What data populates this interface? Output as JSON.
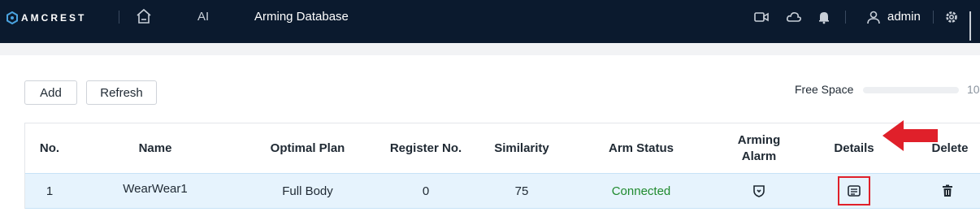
{
  "brand": {
    "logo_text": "AMCREST",
    "logo_icon": "hexagon-logo-icon"
  },
  "nav": {
    "home_icon": "home-icon",
    "ai_label": "AI",
    "current_label": "Arming Database"
  },
  "top_right": {
    "icons": [
      "video-icon",
      "cloud-icon",
      "bell-icon",
      "user-icon",
      "gear-icon"
    ],
    "user_name": "admin"
  },
  "toolbar": {
    "add_label": "Add",
    "refresh_label": "Refresh"
  },
  "free_space": {
    "label": "Free Space",
    "value_text": "10",
    "fill_fraction": 0.0
  },
  "table": {
    "columns": [
      "No.",
      "Name",
      "Optimal Plan",
      "Register No.",
      "Similarity",
      "Arm Status",
      "Arming Alarm",
      "Details",
      "Delete"
    ],
    "rows": [
      {
        "no": "1",
        "name": "WearWear1",
        "optimal_plan": "Full Body",
        "register_no": "0",
        "similarity": "75",
        "arm_status": "Connected",
        "arming_alarm_icon": "shield-alarm-icon",
        "details_icon": "details-icon",
        "delete_icon": "trash-icon"
      }
    ]
  },
  "colors": {
    "topbar": "#0b1a2e",
    "row_highlight": "#e6f3fd",
    "connected": "#1f8a2e",
    "annotation_red": "#e0202a"
  }
}
